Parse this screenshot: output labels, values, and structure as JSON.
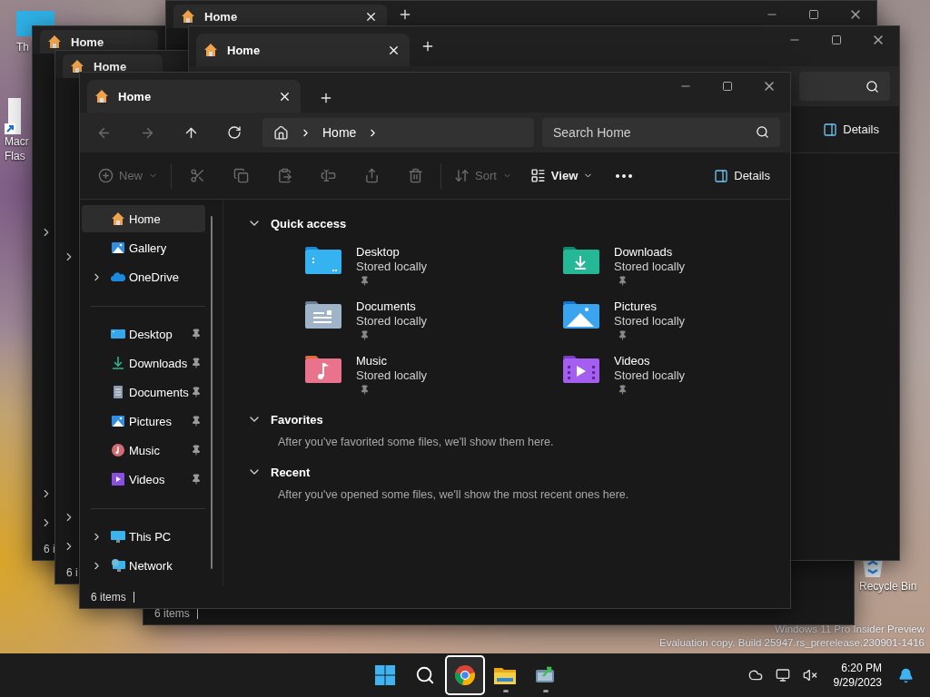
{
  "desktop_icons": [
    {
      "kind": "monitor",
      "lines": [
        "Th"
      ]
    },
    {
      "kind": "shortcut",
      "lines": [
        "Macr",
        "Flas"
      ]
    },
    {
      "kind": "recycle",
      "lines": [
        "Recycle Bin"
      ]
    }
  ],
  "background_windows": [
    {
      "tab": "Home",
      "status": "6 i",
      "expanders": true
    },
    {
      "tab": "Home",
      "window_controls": true
    },
    {
      "tab": "Home",
      "status": "6 i",
      "expanders": true
    },
    {
      "status": "6 items"
    },
    {
      "tab": "Home",
      "window_controls": true,
      "search": true,
      "details": "Details"
    }
  ],
  "window": {
    "tab_title": "Home",
    "nav": [
      {
        "kind": "back",
        "disabled": true
      },
      {
        "kind": "forward",
        "disabled": true
      },
      {
        "kind": "up",
        "disabled": false
      },
      {
        "kind": "refresh",
        "disabled": false
      }
    ],
    "breadcrumb": [
      "Home"
    ],
    "search": {
      "placeholder": "Search Home"
    },
    "toolbar": [
      {
        "kind": "new",
        "label": "New",
        "disabled": true
      },
      {
        "kind": "cut",
        "disabled": true
      },
      {
        "kind": "copy",
        "disabled": true
      },
      {
        "kind": "paste",
        "disabled": true
      },
      {
        "kind": "rename",
        "disabled": true
      },
      {
        "kind": "share",
        "disabled": true
      },
      {
        "kind": "delete",
        "disabled": true
      },
      {
        "kind": "sort",
        "label": "Sort",
        "disabled": true
      },
      {
        "kind": "view",
        "label": "View",
        "disabled": false
      },
      {
        "kind": "more",
        "disabled": false
      }
    ],
    "details_button": "Details",
    "sidebar": {
      "groups": [
        {
          "items": [
            {
              "label": "Home",
              "kind": "home",
              "selected": true,
              "expandable": false,
              "pinned": false
            },
            {
              "label": "Gallery",
              "kind": "gallery",
              "selected": false,
              "expandable": false,
              "pinned": false
            },
            {
              "label": "OneDrive",
              "kind": "onedrive",
              "selected": false,
              "expandable": true,
              "pinned": false
            }
          ]
        },
        {
          "items": [
            {
              "label": "Desktop",
              "kind": "desktop",
              "selected": false,
              "expandable": false,
              "pinned": true
            },
            {
              "label": "Downloads",
              "kind": "downloads",
              "selected": false,
              "expandable": false,
              "pinned": true
            },
            {
              "label": "Documents",
              "kind": "documents",
              "selected": false,
              "expandable": false,
              "pinned": true
            },
            {
              "label": "Pictures",
              "kind": "pictures",
              "selected": false,
              "expandable": false,
              "pinned": true
            },
            {
              "label": "Music",
              "kind": "music",
              "selected": false,
              "expandable": false,
              "pinned": true
            },
            {
              "label": "Videos",
              "kind": "videos",
              "selected": false,
              "expandable": false,
              "pinned": true
            }
          ]
        },
        {
          "items": [
            {
              "label": "This PC",
              "kind": "thispc",
              "selected": false,
              "expandable": true,
              "pinned": false
            },
            {
              "label": "Network",
              "kind": "network",
              "selected": false,
              "expandable": true,
              "pinned": false
            }
          ]
        }
      ]
    },
    "sections": [
      {
        "title": "Quick access",
        "expanded": true,
        "items": [
          {
            "name": "Desktop",
            "kind": "desktop",
            "status": "Stored locally",
            "pinned": true
          },
          {
            "name": "Downloads",
            "kind": "downloads",
            "status": "Stored locally",
            "pinned": true
          },
          {
            "name": "Documents",
            "kind": "documents",
            "status": "Stored locally",
            "pinned": true
          },
          {
            "name": "Pictures",
            "kind": "pictures",
            "status": "Stored locally",
            "pinned": true
          },
          {
            "name": "Music",
            "kind": "music",
            "status": "Stored locally",
            "pinned": true
          },
          {
            "name": "Videos",
            "kind": "videos",
            "status": "Stored locally",
            "pinned": true
          }
        ]
      },
      {
        "title": "Favorites",
        "expanded": true,
        "message": "After you've favorited some files, we'll show them here."
      },
      {
        "title": "Recent",
        "expanded": true,
        "message": "After you've opened some files, we'll show the most recent ones here."
      }
    ],
    "status_bar": "6 items"
  },
  "os_notice": [
    "Windows 11 Pro Insider Preview",
    "Evaluation copy. Build 25947.rs_prerelease.230901-1416"
  ],
  "taskbar": {
    "apps": [
      {
        "kind": "start",
        "selected": false,
        "running": false
      },
      {
        "kind": "search",
        "selected": false,
        "running": false
      },
      {
        "kind": "browser",
        "selected": true,
        "running": false
      },
      {
        "kind": "explorer",
        "selected": false,
        "running": true
      },
      {
        "kind": "app",
        "selected": false,
        "running": true
      }
    ],
    "time": "6:20 PM",
    "date": "9/29/2023"
  }
}
